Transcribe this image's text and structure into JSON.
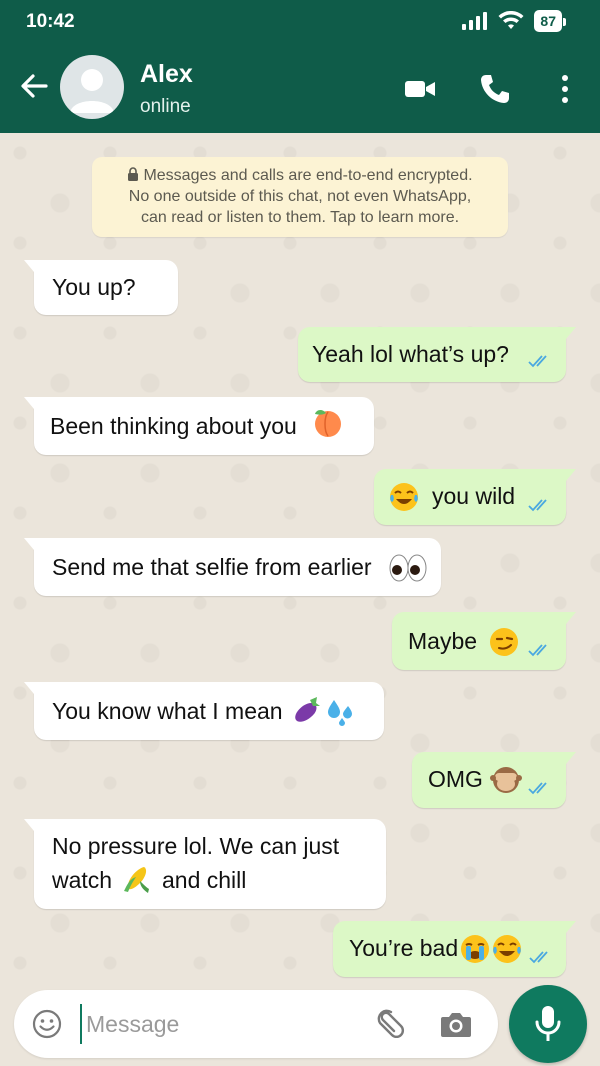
{
  "status_bar": {
    "time": "10:42",
    "battery": "87"
  },
  "header": {
    "contact_name": "Alex",
    "contact_status": "online"
  },
  "notice": {
    "line1": "Messages and calls are end-to-end encrypted.",
    "line2": "No one outside of this chat, not even WhatsApp,",
    "line3": "can read or listen to them. Tap to learn more."
  },
  "messages": [
    {
      "direction": "in",
      "text": "You up?"
    },
    {
      "direction": "out",
      "text": "Yeah lol what’s up?",
      "status": "read"
    },
    {
      "direction": "in",
      "text": "Been thinking about you",
      "emoji": "peach"
    },
    {
      "direction": "out",
      "text": "you wild",
      "emoji_before": "face-with-tears-of-joy",
      "status": "read"
    },
    {
      "direction": "in",
      "text": "Send me that selfie from earlier",
      "emoji": "eyes"
    },
    {
      "direction": "out",
      "text": "Maybe",
      "emoji": "smirking-face",
      "status": "read"
    },
    {
      "direction": "in",
      "text": "You know what I mean",
      "emoji": "eggplant, sweat-droplets"
    },
    {
      "direction": "out",
      "text": "OMG",
      "emoji": "see-no-evil-monkey",
      "status": "read"
    },
    {
      "direction": "in",
      "text_line1": "No pressure lol. We can just",
      "text_line2_a": "watch",
      "text_line2_b": "and chill",
      "emoji": "ear-of-corn"
    },
    {
      "direction": "out",
      "text": "You’re bad",
      "emoji": "loudly-crying-face, face-with-tears-of-joy",
      "status": "read"
    }
  ],
  "composer": {
    "placeholder": "Message"
  },
  "colors": {
    "header": "#0f5c49",
    "accent": "#0f7a5f",
    "outgoing_bubble": "#dcf8c6",
    "incoming_bubble": "#ffffff",
    "notice_bg": "#fcf3d4",
    "read_ticks": "#4aa8e0"
  },
  "icons": [
    "back-arrow-icon",
    "video-call-icon",
    "phone-icon",
    "more-vertical-icon",
    "lock-icon",
    "double-check-icon",
    "emoji-icon",
    "attach-icon",
    "camera-icon",
    "mic-icon"
  ]
}
